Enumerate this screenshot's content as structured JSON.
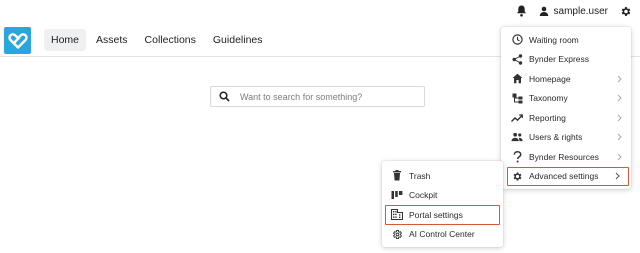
{
  "header": {
    "username": "sample.user"
  },
  "nav": {
    "items": [
      {
        "label": "Home",
        "active": true
      },
      {
        "label": "Assets"
      },
      {
        "label": "Collections"
      },
      {
        "label": "Guidelines"
      }
    ]
  },
  "search": {
    "placeholder": "Want to search for something?"
  },
  "settings_menu": {
    "items": [
      {
        "label": "Waiting room",
        "icon": "clock-icon",
        "has_submenu": false
      },
      {
        "label": "Bynder Express",
        "icon": "share-icon",
        "has_submenu": false
      },
      {
        "label": "Homepage",
        "icon": "home-icon",
        "has_submenu": true
      },
      {
        "label": "Taxonomy",
        "icon": "taxonomy-icon",
        "has_submenu": true
      },
      {
        "label": "Reporting",
        "icon": "trend-icon",
        "has_submenu": true
      },
      {
        "label": "Users & rights",
        "icon": "users-icon",
        "has_submenu": true
      },
      {
        "label": "Bynder Resources",
        "icon": "question-icon",
        "has_submenu": true
      },
      {
        "label": "Advanced settings",
        "icon": "gear-icon",
        "has_submenu": true,
        "highlighted": true
      }
    ]
  },
  "advanced_submenu": {
    "items": [
      {
        "label": "Trash",
        "icon": "trash-icon"
      },
      {
        "label": "Cockpit",
        "icon": "cockpit-icon"
      },
      {
        "label": "Portal settings",
        "icon": "building-icon",
        "highlighted": true
      },
      {
        "label": "AI Control Center",
        "icon": "ai-gear-icon"
      }
    ]
  },
  "colors": {
    "brand": "#2aa6df",
    "highlight_border": "#d9553a",
    "active_tab_bg": "#eef0f2"
  }
}
